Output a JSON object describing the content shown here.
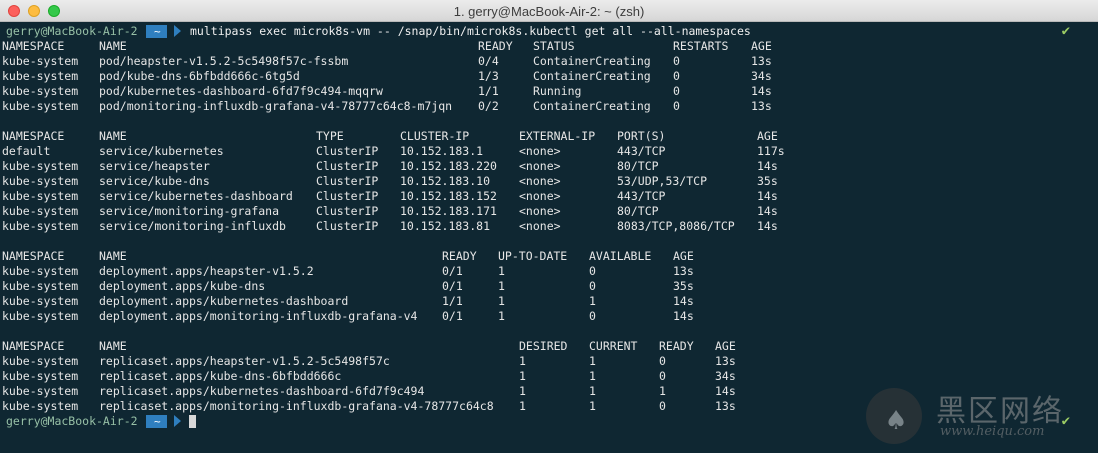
{
  "window": {
    "title": "1. gerry@MacBook-Air-2: ~ (zsh)"
  },
  "prompt": {
    "user": "gerry@MacBook-Air-2",
    "dir": "~",
    "status_icon": "✔"
  },
  "command": "multipass exec microk8s-vm -- /snap/bin/microk8s.kubectl get all --all-namespaces",
  "sections": [
    {
      "name": "pods",
      "headers": [
        "NAMESPACE",
        "NAME",
        "READY",
        "STATUS",
        "RESTARTS",
        "AGE"
      ],
      "rows": [
        [
          "kube-system",
          "pod/heapster-v1.5.2-5c5498f57c-fssbm",
          "0/4",
          "ContainerCreating",
          "0",
          "13s"
        ],
        [
          "kube-system",
          "pod/kube-dns-6bfbdd666c-6tg5d",
          "1/3",
          "ContainerCreating",
          "0",
          "34s"
        ],
        [
          "kube-system",
          "pod/kubernetes-dashboard-6fd7f9c494-mqqrw",
          "1/1",
          "Running",
          "0",
          "14s"
        ],
        [
          "kube-system",
          "pod/monitoring-influxdb-grafana-v4-78777c64c8-m7jqn",
          "0/2",
          "ContainerCreating",
          "0",
          "13s"
        ]
      ]
    },
    {
      "name": "services",
      "headers": [
        "NAMESPACE",
        "NAME",
        "TYPE",
        "CLUSTER-IP",
        "EXTERNAL-IP",
        "PORT(S)",
        "AGE"
      ],
      "rows": [
        [
          "default",
          "service/kubernetes",
          "ClusterIP",
          "10.152.183.1",
          "<none>",
          "443/TCP",
          "117s"
        ],
        [
          "kube-system",
          "service/heapster",
          "ClusterIP",
          "10.152.183.220",
          "<none>",
          "80/TCP",
          "14s"
        ],
        [
          "kube-system",
          "service/kube-dns",
          "ClusterIP",
          "10.152.183.10",
          "<none>",
          "53/UDP,53/TCP",
          "35s"
        ],
        [
          "kube-system",
          "service/kubernetes-dashboard",
          "ClusterIP",
          "10.152.183.152",
          "<none>",
          "443/TCP",
          "14s"
        ],
        [
          "kube-system",
          "service/monitoring-grafana",
          "ClusterIP",
          "10.152.183.171",
          "<none>",
          "80/TCP",
          "14s"
        ],
        [
          "kube-system",
          "service/monitoring-influxdb",
          "ClusterIP",
          "10.152.183.81",
          "<none>",
          "8083/TCP,8086/TCP",
          "14s"
        ]
      ]
    },
    {
      "name": "deployments",
      "headers": [
        "NAMESPACE",
        "NAME",
        "READY",
        "UP-TO-DATE",
        "AVAILABLE",
        "AGE"
      ],
      "rows": [
        [
          "kube-system",
          "deployment.apps/heapster-v1.5.2",
          "0/1",
          "1",
          "0",
          "13s"
        ],
        [
          "kube-system",
          "deployment.apps/kube-dns",
          "0/1",
          "1",
          "0",
          "35s"
        ],
        [
          "kube-system",
          "deployment.apps/kubernetes-dashboard",
          "1/1",
          "1",
          "1",
          "14s"
        ],
        [
          "kube-system",
          "deployment.apps/monitoring-influxdb-grafana-v4",
          "0/1",
          "1",
          "0",
          "14s"
        ]
      ]
    },
    {
      "name": "replicasets",
      "headers": [
        "NAMESPACE",
        "NAME",
        "DESIRED",
        "CURRENT",
        "READY",
        "AGE"
      ],
      "rows": [
        [
          "kube-system",
          "replicaset.apps/heapster-v1.5.2-5c5498f57c",
          "1",
          "1",
          "0",
          "13s"
        ],
        [
          "kube-system",
          "replicaset.apps/kube-dns-6bfbdd666c",
          "1",
          "1",
          "0",
          "34s"
        ],
        [
          "kube-system",
          "replicaset.apps/kubernetes-dashboard-6fd7f9c494",
          "1",
          "1",
          "1",
          "14s"
        ],
        [
          "kube-system",
          "replicaset.apps/monitoring-influxdb-grafana-v4-78777c64c8",
          "1",
          "1",
          "0",
          "13s"
        ]
      ]
    }
  ],
  "watermark": {
    "logo_icon": "mushroom-logo-icon",
    "text_cn": "黑区网络",
    "url": "www.heiqu.com"
  },
  "colors": {
    "background": "#0f2732",
    "text": "#e6e6e6",
    "prompt_segment": "#2f7fbf",
    "status_ok": "#9ccc65"
  }
}
